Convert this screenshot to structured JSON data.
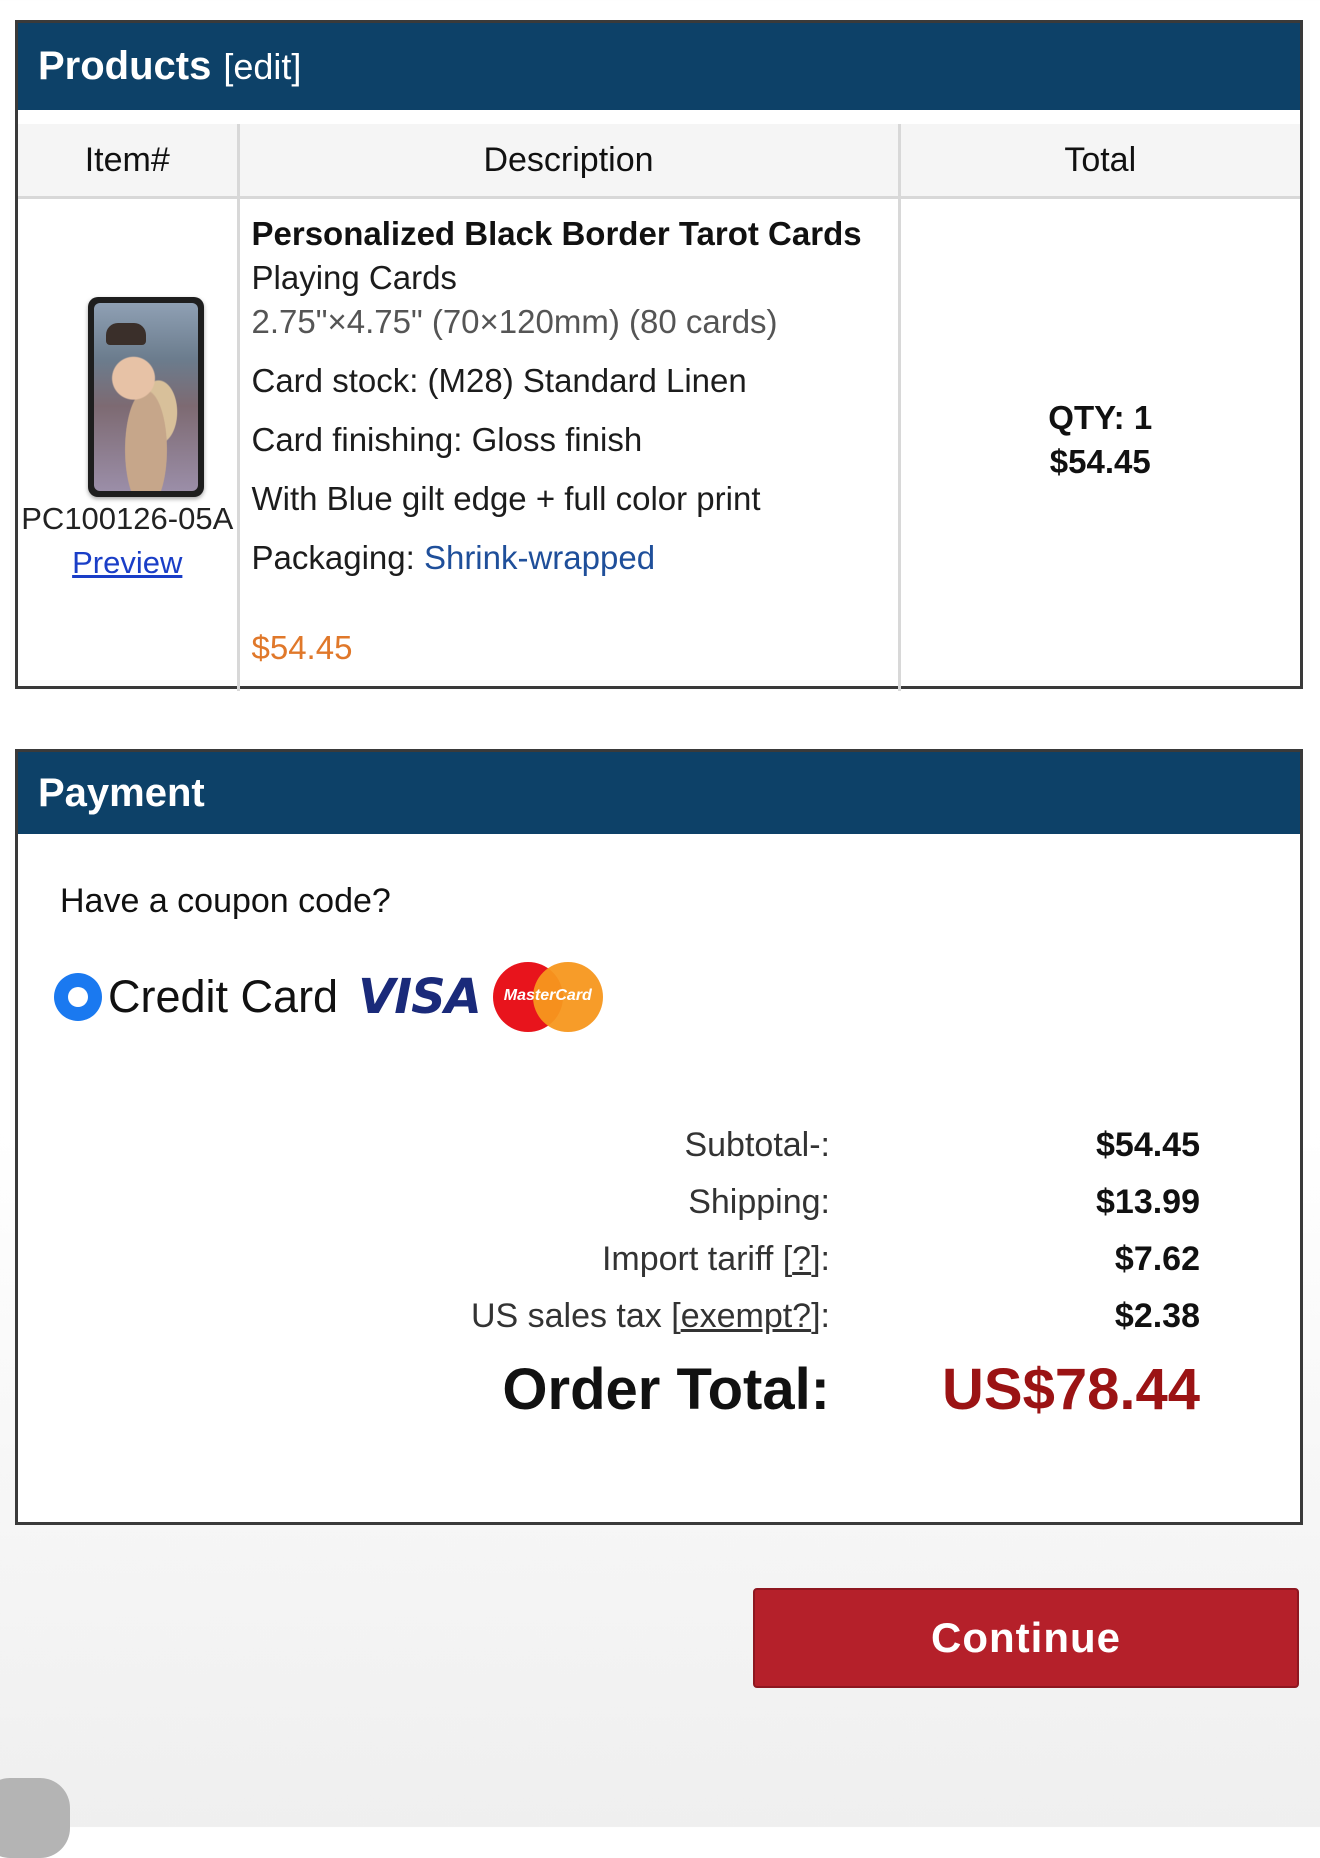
{
  "products": {
    "title": "Products",
    "edit_label": "[edit]",
    "columns": [
      "Item#",
      "Description",
      "Total"
    ],
    "item": {
      "number": "PC100126-05A",
      "preview_label": "Preview",
      "name": "Personalized Black Border Tarot Cards",
      "category": "Playing Cards",
      "size": "2.75\"×4.75\" (70×120mm) (80 cards)",
      "card_stock": "Card stock: (M28) Standard Linen",
      "card_finishing": "Card finishing: Gloss finish",
      "edge": "With Blue gilt edge + full color print",
      "packaging_label": "Packaging: ",
      "packaging_value": "Shrink-wrapped",
      "price": "$54.45",
      "qty": "QTY: 1",
      "line_total": "$54.45"
    }
  },
  "payment": {
    "title": "Payment",
    "coupon_prompt": "Have a coupon code?",
    "method_label": "Credit Card",
    "visa_text": "VISA",
    "mastercard_text": "MasterCard",
    "subtotal_label": "Subtotal-:",
    "subtotal_value": "$54.45",
    "shipping_label": "Shipping:",
    "shipping_value": "$13.99",
    "tariff_label_prefix": "Import tariff [",
    "tariff_link": "?",
    "tariff_label_suffix": "]:",
    "tariff_value": "$7.62",
    "tax_label_prefix": "US sales tax [",
    "tax_link": "exempt?",
    "tax_label_suffix": "]:",
    "tax_value": "$2.38",
    "order_total_label": "Order Total:",
    "order_total_value": "US$78.44"
  },
  "continue_label": "Continue",
  "colors": {
    "header_bg": "#0d4168",
    "price_orange": "#e0782a",
    "total_red": "#9b1314",
    "button_red": "#b5202a",
    "radio_blue": "#1a79f0"
  }
}
